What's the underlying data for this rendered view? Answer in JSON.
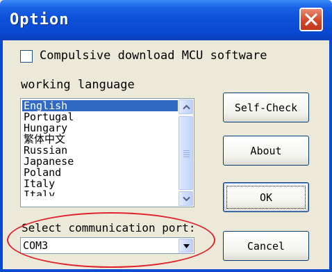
{
  "window": {
    "title": "Option",
    "close_icon": "close-icon"
  },
  "compulsive": {
    "label": "Compulsive download MCU software",
    "checked": false
  },
  "language": {
    "label": "working language",
    "items": [
      "English",
      "Portugal",
      "Hungary",
      "繁体中文",
      "Russian",
      "Japanese",
      "Poland",
      "Italy",
      "Italy"
    ],
    "selected": "English"
  },
  "port": {
    "label": "Select communication port:",
    "value": "COM3"
  },
  "buttons": {
    "self_check": "Self-Check",
    "about": "About",
    "ok": "OK",
    "cancel": "Cancel"
  },
  "colors": {
    "title_bar": "#0a49d1",
    "selection": "#316ac5",
    "highlight_ellipse": "#e0202a",
    "close_button": "#d1482a"
  }
}
